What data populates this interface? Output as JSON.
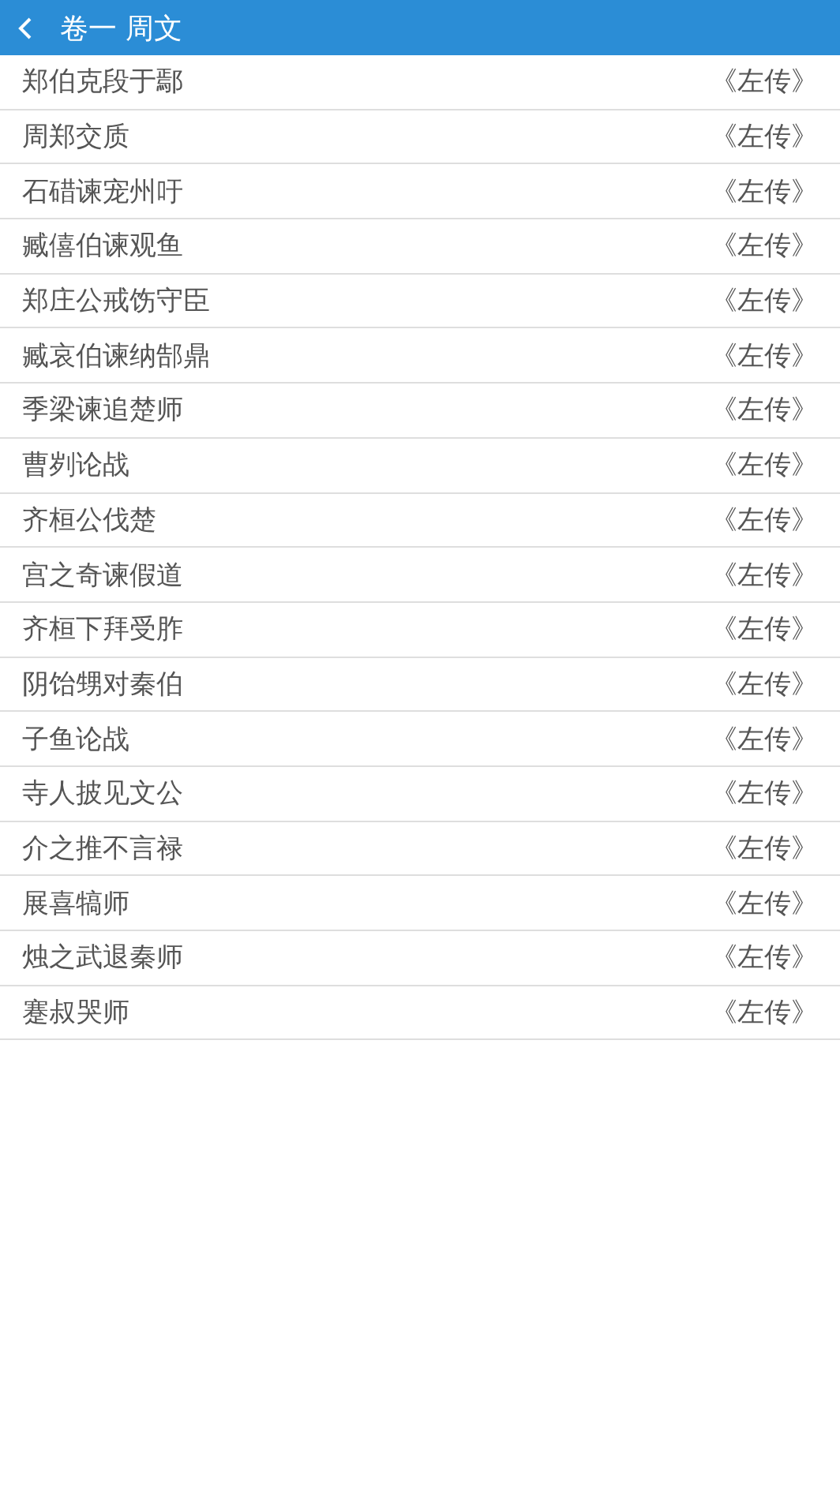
{
  "header": {
    "title": "卷一 周文"
  },
  "items": [
    {
      "title": "郑伯克段于鄢",
      "source": "《左传》"
    },
    {
      "title": "周郑交质",
      "source": "《左传》"
    },
    {
      "title": "石碏谏宠州吁",
      "source": "《左传》"
    },
    {
      "title": "臧僖伯谏观鱼",
      "source": "《左传》"
    },
    {
      "title": "郑庄公戒饬守臣",
      "source": "《左传》"
    },
    {
      "title": "臧哀伯谏纳郜鼎",
      "source": "《左传》"
    },
    {
      "title": "季梁谏追楚师",
      "source": "《左传》"
    },
    {
      "title": "曹刿论战",
      "source": "《左传》"
    },
    {
      "title": "齐桓公伐楚",
      "source": "《左传》"
    },
    {
      "title": "宫之奇谏假道",
      "source": "《左传》"
    },
    {
      "title": "齐桓下拜受胙",
      "source": "《左传》"
    },
    {
      "title": "阴饴甥对秦伯",
      "source": "《左传》"
    },
    {
      "title": "子鱼论战",
      "source": "《左传》"
    },
    {
      "title": "寺人披见文公",
      "source": "《左传》"
    },
    {
      "title": "介之推不言禄",
      "source": "《左传》"
    },
    {
      "title": "展喜犒师",
      "source": "《左传》"
    },
    {
      "title": "烛之武退秦师",
      "source": "《左传》"
    },
    {
      "title": "蹇叔哭师",
      "source": "《左传》"
    }
  ]
}
